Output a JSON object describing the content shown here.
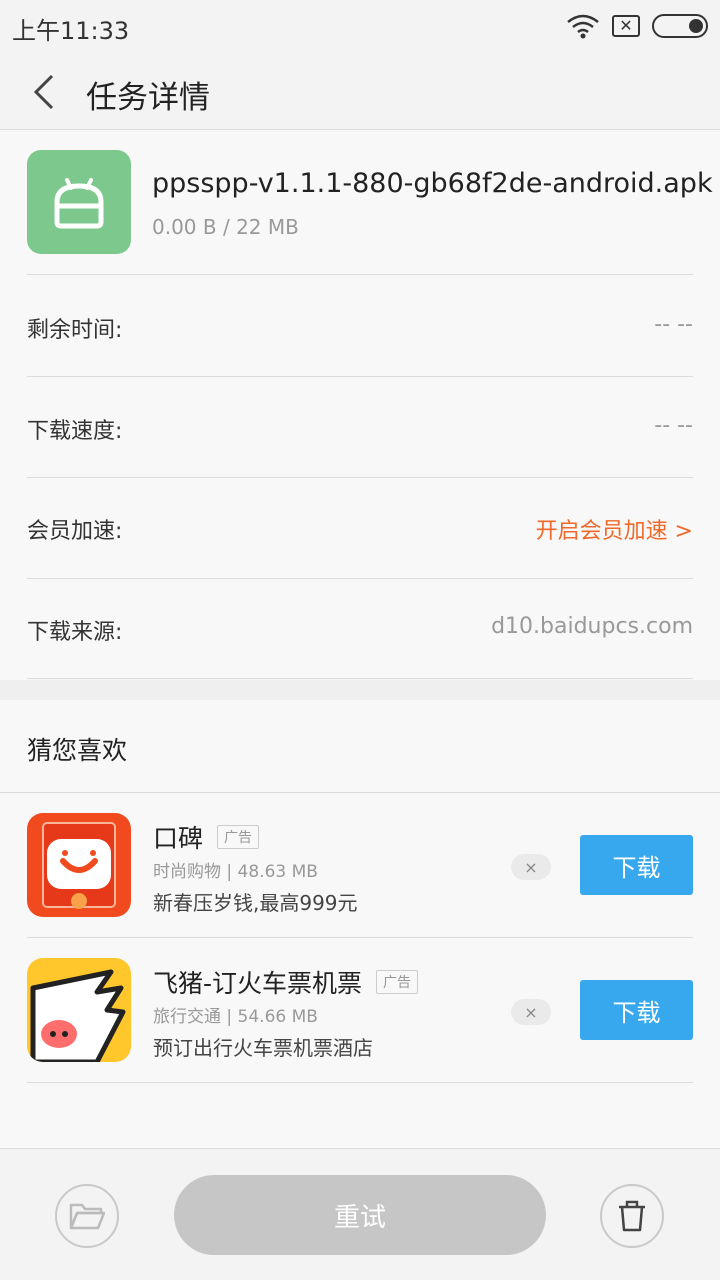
{
  "status_bar": {
    "time": "上午11:33",
    "icons": [
      "wifi-icon",
      "no-sim-icon",
      "battery-icon"
    ]
  },
  "header": {
    "back_icon": "chevron-left-icon",
    "title": "任务详情"
  },
  "file": {
    "icon": "android-apk-icon",
    "name": "ppsspp-v1.1.1-880-gb68f2de-android.apk",
    "size": "0.00 B / 22 MB"
  },
  "details": [
    {
      "label": "剩余时间:",
      "value": "-- --"
    },
    {
      "label": "下载速度:",
      "value": "-- --"
    },
    {
      "label": "会员加速:",
      "value": "开启会员加速 >"
    },
    {
      "label": "下载来源:",
      "value": "d10.baidupcs.com"
    }
  ],
  "recommend": {
    "title": "猜您喜欢",
    "apps": [
      {
        "name": "口碑",
        "ad_tag": "广告",
        "meta": "时尚购物 | 48.63 MB",
        "desc": "新春压岁钱,最高999元",
        "dismiss": "×",
        "download": "下载",
        "icon": "koubei-app-icon"
      },
      {
        "name": "飞猪-订火车票机票",
        "ad_tag": "广告",
        "meta": "旅行交通 | 54.66 MB",
        "desc": "预订出行火车票机票酒店",
        "dismiss": "×",
        "download": "下载",
        "icon": "feizhu-app-icon"
      }
    ]
  },
  "bottom": {
    "folder_icon": "folder-icon",
    "retry": "重试",
    "trash_icon": "trash-icon"
  },
  "colors": {
    "accent_orange": "#ef6a2a",
    "download_blue": "#37a8ee",
    "apk_green": "#7dc98d"
  },
  "status_bar_sb_x": "✕"
}
